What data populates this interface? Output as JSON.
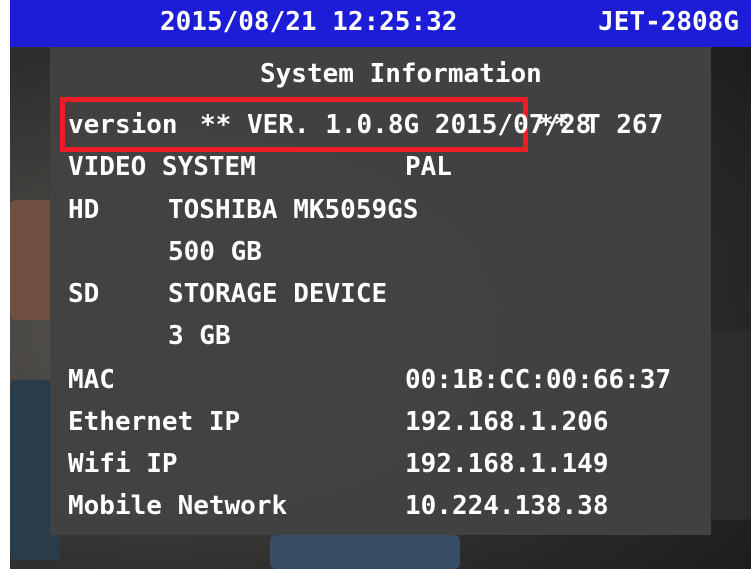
{
  "top_bar": {
    "datetime": "2015/08/21 12:25:32",
    "model": "JET-2808G",
    "background_color": "#1d1dd8"
  },
  "panel": {
    "title": "System Information",
    "version": {
      "label": "version",
      "value": "** VER. 1.0.8G 2015/07/28",
      "suffix": "** T 267",
      "highlight_color": "#ee1c25"
    },
    "video_system": {
      "label": "VIDEO SYSTEM",
      "value": "PAL"
    },
    "hd": {
      "label": "HD",
      "model": "TOSHIBA MK5059GS",
      "size": "500 GB"
    },
    "sd": {
      "label": "SD",
      "name": "STORAGE DEVICE",
      "size": "3 GB"
    },
    "mac": {
      "label": "MAC",
      "value": "00:1B:CC:00:66:37"
    },
    "ethernet_ip": {
      "label": "Ethernet IP",
      "value": "192.168.1.206"
    },
    "wifi_ip": {
      "label": "Wifi IP",
      "value": "192.168.1.149"
    },
    "mobile_network": {
      "label": "Mobile Network",
      "value": "10.224.138.38"
    }
  }
}
